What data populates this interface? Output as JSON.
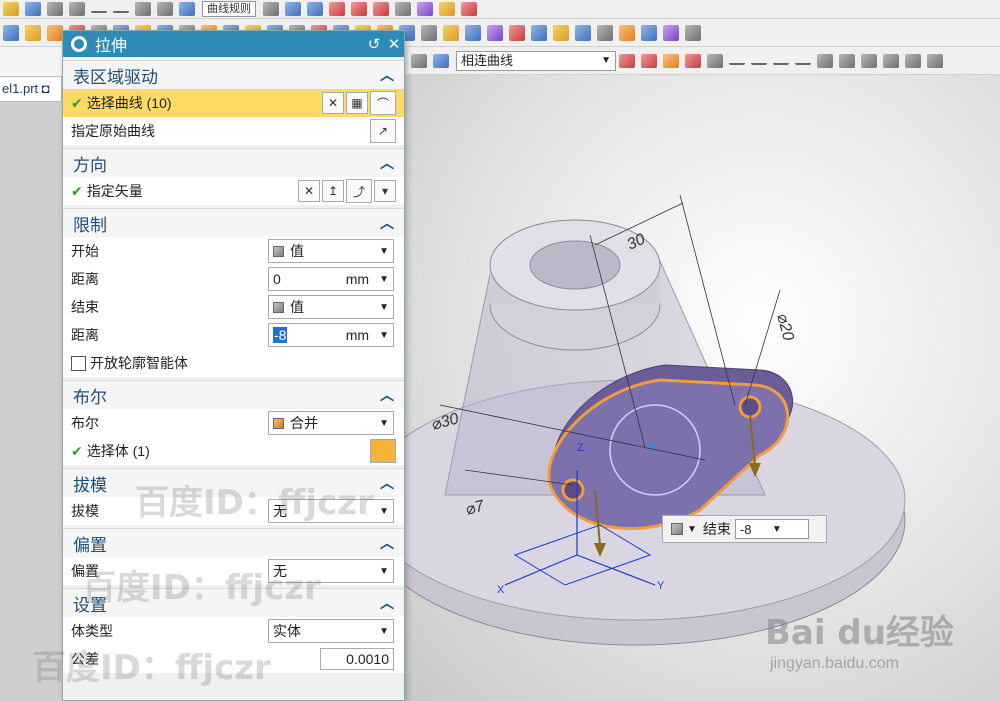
{
  "toolbar": {
    "row1_select": "曲线规则",
    "row3_select": "相连曲线"
  },
  "file_tab": {
    "label": "el1.prt"
  },
  "dialog": {
    "title": "拉伸",
    "sections": {
      "section_drive": {
        "title": "表区域驱动",
        "select_curve": "选择曲线 (10)",
        "specify_origin_curve": "指定原始曲线"
      },
      "direction": {
        "title": "方向",
        "specify_vector": "指定矢量"
      },
      "limits": {
        "title": "限制",
        "start_label": "开始",
        "start_value": "值",
        "start_distance_label": "距离",
        "start_distance": "0",
        "end_label": "结束",
        "end_value": "值",
        "end_distance_label": "距离",
        "end_distance": "-8",
        "unit": "mm",
        "open_profile": "开放轮廓智能体"
      },
      "boolean": {
        "title": "布尔",
        "label": "布尔",
        "value": "合并",
        "select_body": "选择体 (1)"
      },
      "draft": {
        "title": "拔模",
        "label": "拔模",
        "value": "无"
      },
      "offset": {
        "title": "偏置",
        "label": "偏置",
        "value": "无"
      },
      "settings": {
        "title": "设置",
        "body_type_label": "体类型",
        "body_type": "实体",
        "tolerance_label": "公差",
        "tolerance": "0.0010"
      }
    }
  },
  "canvas": {
    "dim_top": "30",
    "dim_right": "⌀20",
    "dim_left": "⌀30",
    "dim_small": "⌀7",
    "axis_x": "X",
    "axis_y": "Y",
    "axis_z": "Z"
  },
  "float_input": {
    "label": "结束",
    "value": "-8"
  },
  "watermarks": {
    "w1": "百度ID：ffjczr",
    "w2": "百度ID：ffjczr",
    "w3": "百度ID：ffjczr",
    "baidu": "Bai du经验",
    "baidu_url": "jingyan.baidu.com"
  },
  "colors": {
    "title_bar": "#2e8bb8",
    "highlight": "#ffd966",
    "profile": "#f39c3c",
    "solid": "#6a5d9a"
  }
}
